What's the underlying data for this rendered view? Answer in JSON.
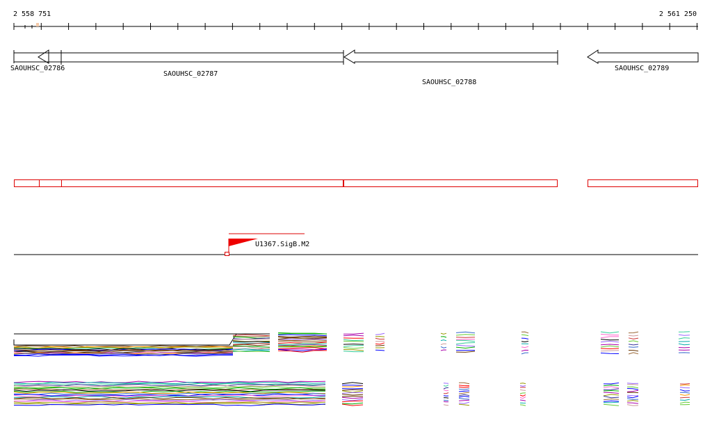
{
  "coords": {
    "start_label": "2 558 751",
    "end_label": "2 561 250"
  },
  "genes": [
    {
      "id": "SAOUHSC_02786"
    },
    {
      "id": "SAOUHSC_02787"
    },
    {
      "id": "SAOUHSC_02788"
    },
    {
      "id": "SAOUHSC_02789"
    }
  ],
  "motif": {
    "label": "U1367.SigB.M2"
  },
  "colors": {
    "axis": "#000000",
    "gene_outline": "#000000",
    "region_outline": "#dd0000",
    "motif": "#ee0000",
    "highlight": "#c87533"
  },
  "tracks": {
    "palette": [
      "#ff0000",
      "#00aa00",
      "#0000ff",
      "#ff9900",
      "#aa00aa",
      "#00aaaa",
      "#999900",
      "#ff66cc",
      "#663300",
      "#000000",
      "#cc3333",
      "#3366cc",
      "#66cc33",
      "#996633",
      "#9966ff",
      "#cc9999",
      "#333399",
      "#33cc99"
    ]
  }
}
